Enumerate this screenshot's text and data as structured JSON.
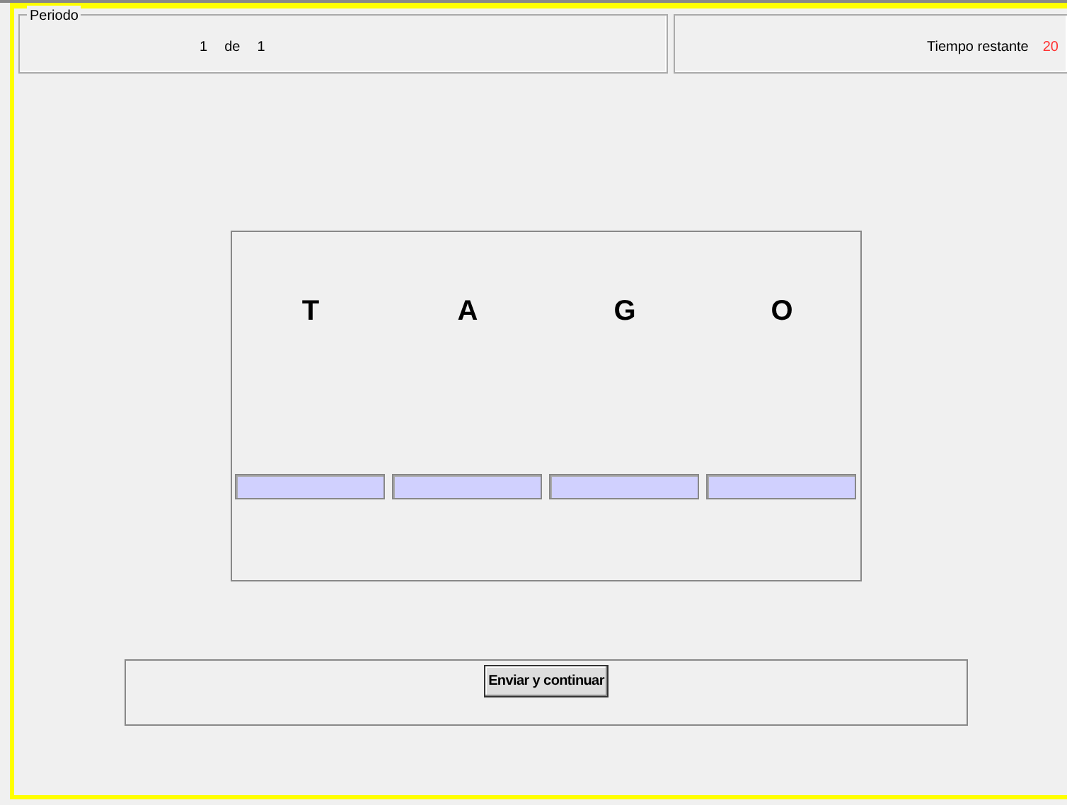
{
  "period": {
    "legend": "Periodo",
    "current": "1",
    "separator": "de",
    "total": "1"
  },
  "timer": {
    "label": "Tiempo restante",
    "value": "20"
  },
  "letters": [
    "T",
    "A",
    "G",
    "O"
  ],
  "answer_fields": [
    {
      "kind": "text"
    },
    {
      "kind": "text"
    },
    {
      "kind": "text"
    },
    {
      "kind": "text"
    }
  ],
  "submit_button": "Enviar y continuar"
}
